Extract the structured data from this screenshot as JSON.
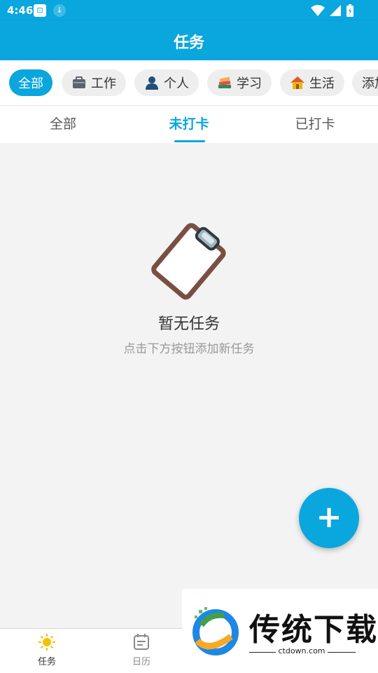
{
  "status_bar": {
    "time": "4:46"
  },
  "app_bar": {
    "title": "任务"
  },
  "categories": [
    {
      "label": "全部",
      "icon": "",
      "active": true
    },
    {
      "label": "工作",
      "icon": "briefcase-icon",
      "active": false
    },
    {
      "label": "个人",
      "icon": "person-icon",
      "active": false
    },
    {
      "label": "学习",
      "icon": "books-icon",
      "active": false
    },
    {
      "label": "生活",
      "icon": "house-icon",
      "active": false
    },
    {
      "label": "添加",
      "icon": "",
      "active": false
    }
  ],
  "tabs": [
    {
      "label": "全部",
      "active": false
    },
    {
      "label": "未打卡",
      "active": true
    },
    {
      "label": "已打卡",
      "active": false
    }
  ],
  "empty_state": {
    "icon": "clipboard-icon",
    "title": "暂无任务",
    "subtitle": "点击下方按钮添加新任务"
  },
  "fab": {
    "label": "+"
  },
  "bottom_nav": [
    {
      "label": "任务",
      "icon": "sun-icon",
      "active": true
    },
    {
      "label": "日历",
      "icon": "calendar-icon",
      "active": false
    }
  ],
  "watermark": {
    "text": "传统下载",
    "url": "ctdown.com"
  },
  "colors": {
    "primary": "#0aa6de",
    "background": "#f3f3f3",
    "chip_bg": "#eeeeee"
  }
}
